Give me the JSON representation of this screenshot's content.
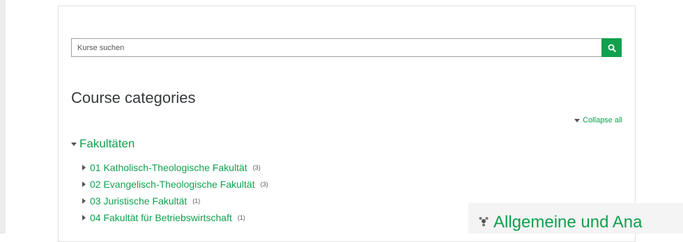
{
  "search": {
    "placeholder": "Kurse suchen"
  },
  "heading": "Course categories",
  "collapse_all": "Collapse all",
  "top_category": {
    "label": "Fakultäten"
  },
  "categories": [
    {
      "label": "01 Katholisch-Theologische Fakultät",
      "count": "(3)"
    },
    {
      "label": "02 Evangelisch-Theologische Fakultät",
      "count": "(3)"
    },
    {
      "label": "03 Juristische Fakultät",
      "count": "(1)"
    },
    {
      "label": "04 Fakultät für Betriebswirtschaft",
      "count": "(1)"
    }
  ],
  "promo": {
    "title": "Allgemeine und Ana"
  },
  "colors": {
    "accent": "#10a14e",
    "text": "#373a3c",
    "border": "#dfdfdf"
  },
  "icons": {
    "search": "search-icon",
    "promo": "puzzle-icon"
  }
}
